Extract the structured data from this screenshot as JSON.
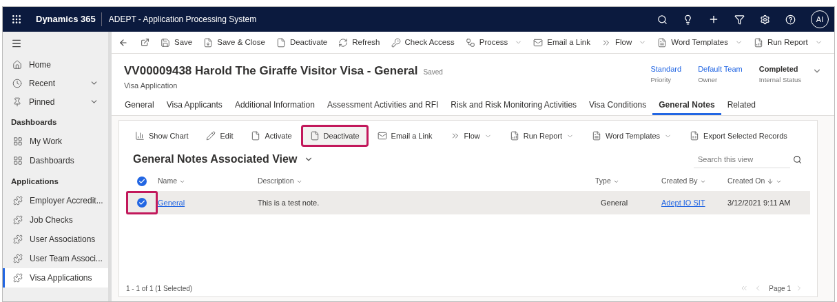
{
  "topbar": {
    "app": "Dynamics 365",
    "title": "ADEPT - Application Processing System",
    "avatar": "AI"
  },
  "sidebar": {
    "nav": [
      {
        "label": "Home",
        "kind": "home",
        "dropdown": false
      },
      {
        "label": "Recent",
        "kind": "recent",
        "dropdown": true
      },
      {
        "label": "Pinned",
        "kind": "pinned",
        "dropdown": true
      }
    ],
    "sections": [
      {
        "heading": "Dashboards",
        "items": [
          {
            "label": "My Work",
            "kind": "dashboard",
            "selected": false
          },
          {
            "label": "Dashboards",
            "kind": "dashboard",
            "selected": false
          }
        ]
      },
      {
        "heading": "Applications",
        "items": [
          {
            "label": "Employer Accredit...",
            "kind": "entity",
            "selected": false
          },
          {
            "label": "Job Checks",
            "kind": "entity",
            "selected": false
          },
          {
            "label": "User Associations",
            "kind": "entity",
            "selected": false
          },
          {
            "label": "User Team Associ...",
            "kind": "entity",
            "selected": false
          },
          {
            "label": "Visa Applications",
            "kind": "entity",
            "selected": true
          }
        ]
      }
    ]
  },
  "commands": [
    {
      "label": "Save",
      "dropdown": false
    },
    {
      "label": "Save & Close",
      "dropdown": false
    },
    {
      "label": "Deactivate",
      "dropdown": false
    },
    {
      "label": "Refresh",
      "dropdown": false
    },
    {
      "label": "Check Access",
      "dropdown": false
    },
    {
      "label": "Process",
      "dropdown": true
    },
    {
      "label": "Email a Link",
      "dropdown": false
    },
    {
      "label": "Flow",
      "dropdown": true
    },
    {
      "label": "Word Templates",
      "dropdown": true
    },
    {
      "label": "Run Report",
      "dropdown": true
    }
  ],
  "record": {
    "title": "VV00009438 Harold The Giraffe Visitor Visa - General",
    "status": "Saved",
    "entity": "Visa Application",
    "fields": [
      {
        "value": "Standard",
        "label": "Priority",
        "link": true
      },
      {
        "value": "Default Team",
        "label": "Owner",
        "link": true
      },
      {
        "value": "Completed",
        "label": "Internal Status",
        "link": false
      }
    ]
  },
  "tabs": [
    {
      "label": "General",
      "selected": false
    },
    {
      "label": "Visa Applicants",
      "selected": false
    },
    {
      "label": "Additional Information",
      "selected": false
    },
    {
      "label": "Assessment Activities and RFI",
      "selected": false
    },
    {
      "label": "Risk and Risk Monitoring Activities",
      "selected": false
    },
    {
      "label": "Visa Conditions",
      "selected": false
    },
    {
      "label": "General Notes",
      "selected": true
    },
    {
      "label": "Related",
      "selected": false
    }
  ],
  "subgrid": {
    "commands": [
      {
        "label": "Show Chart",
        "dropdown": false,
        "highlighted": false
      },
      {
        "label": "Edit",
        "dropdown": false,
        "highlighted": false
      },
      {
        "label": "Activate",
        "dropdown": false,
        "highlighted": false
      },
      {
        "label": "Deactivate",
        "dropdown": false,
        "highlighted": true
      },
      {
        "label": "Email a Link",
        "dropdown": false,
        "highlighted": false
      },
      {
        "label": "Flow",
        "dropdown": true,
        "highlighted": false
      },
      {
        "label": "Run Report",
        "dropdown": true,
        "highlighted": false
      },
      {
        "label": "Word Templates",
        "dropdown": true,
        "highlighted": false
      },
      {
        "label": "Export Selected Records",
        "dropdown": false,
        "highlighted": false
      }
    ],
    "view_title": "General Notes Associated View",
    "search": {
      "placeholder": "Search this view"
    },
    "all_selected": true,
    "columns": [
      {
        "label": "Name",
        "sorted": false
      },
      {
        "label": "Description",
        "sorted": false
      },
      {
        "label": "Type",
        "sorted": false
      },
      {
        "label": "Created By",
        "sorted": false
      },
      {
        "label": "Created On",
        "sorted": true
      }
    ],
    "rows": [
      {
        "selected": true,
        "highlighted": true,
        "cells": [
          {
            "text": "General",
            "link": true
          },
          {
            "text": "This is a test note.",
            "link": false
          },
          {
            "text": "General",
            "link": false
          },
          {
            "text": "Adept IO SIT",
            "link": true
          },
          {
            "text": "3/12/2021 9:11 AM",
            "link": false
          }
        ]
      }
    ],
    "footer": "1 - 1 of 1 (1 Selected)",
    "page": "Page 1"
  }
}
